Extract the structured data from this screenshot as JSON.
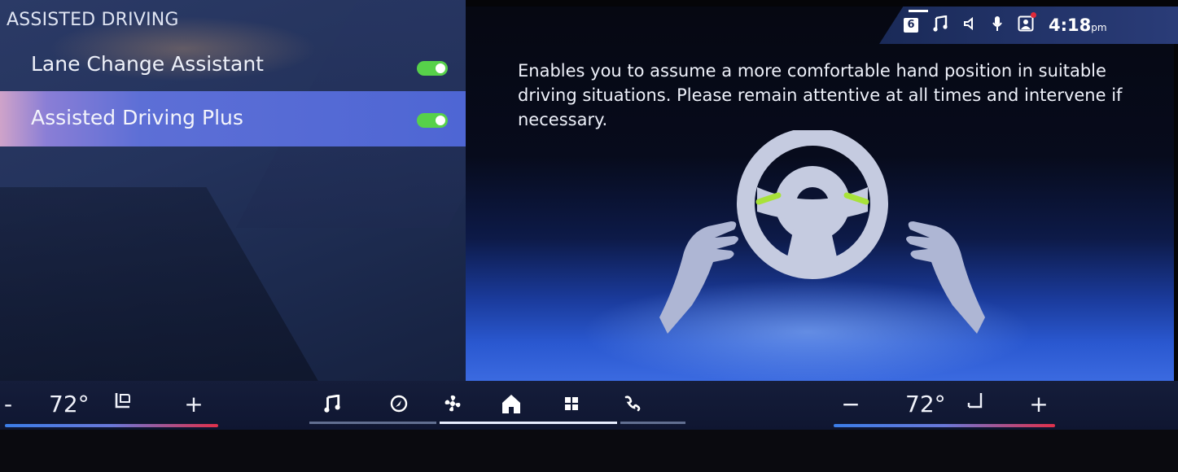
{
  "left_panel": {
    "section_title": "ASSISTED DRIVING",
    "items": [
      {
        "label": "Lane Change Assistant",
        "toggle_on": true
      },
      {
        "label": "Assisted Driving Plus",
        "toggle_on": true,
        "selected": true
      }
    ]
  },
  "status_bar": {
    "badge": "6",
    "icons": [
      "music-note-icon",
      "volume-icon",
      "microphone-icon",
      "profile-icon"
    ],
    "time": "4:18",
    "time_suffix": "pm",
    "notification_color": "#e02a3a"
  },
  "info": {
    "description": "Enables you to assume a more comfortable hand position in suitable driving situations. Please remain attentive at all times and intervene if necessary."
  },
  "climate": {
    "left": {
      "minus": "-",
      "temperature": "72°",
      "plus": "+",
      "icon": "seat-heat-icon"
    },
    "right": {
      "minus": "−",
      "temperature": "72°",
      "plus": "+",
      "icon": "seat-icon"
    }
  },
  "nav": {
    "items": [
      "music-icon",
      "navigation-icon",
      "fan-icon",
      "home-icon",
      "apps-icon",
      "phone-icon"
    ],
    "active": "home-icon"
  },
  "colors": {
    "toggle_on": "#57d14a",
    "accent_blue": "#4e66d4",
    "steering_highlight": "#a8e23a"
  }
}
